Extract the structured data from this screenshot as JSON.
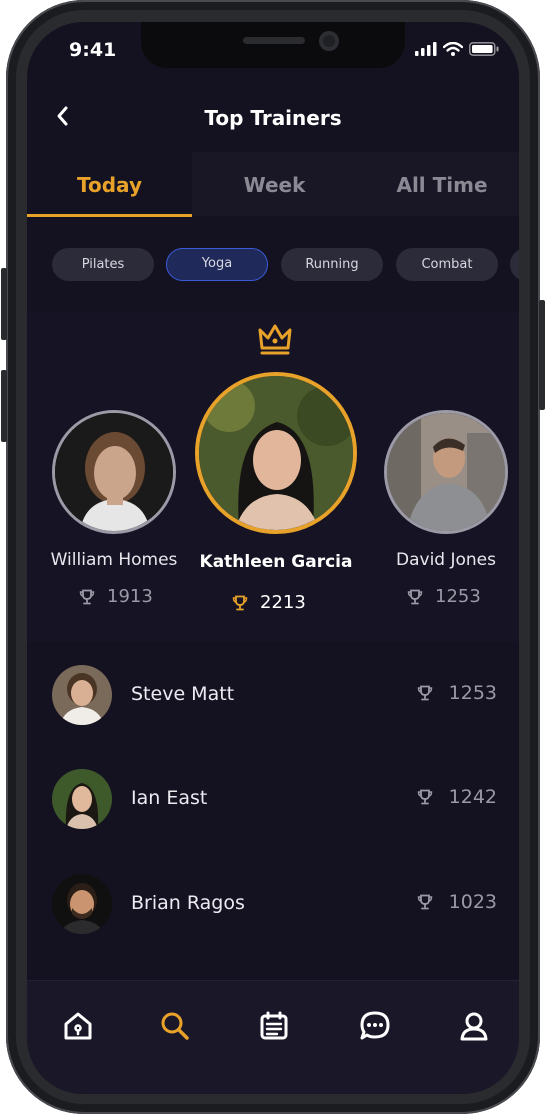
{
  "status": {
    "time": "9:41"
  },
  "header": {
    "title": "Top Trainers"
  },
  "tabs": [
    {
      "label": "Today",
      "active": true
    },
    {
      "label": "Week",
      "active": false
    },
    {
      "label": "All Time",
      "active": false
    }
  ],
  "categories": [
    {
      "label": "Pilates",
      "active": false
    },
    {
      "label": "Yoga",
      "active": true
    },
    {
      "label": "Running",
      "active": false
    },
    {
      "label": "Combat",
      "active": false
    }
  ],
  "podium": {
    "first": {
      "name": "Kathleen Garcia",
      "score": "2213",
      "icon": "crown-icon"
    },
    "second": {
      "name": "William Homes",
      "score": "1913"
    },
    "third": {
      "name": "David Jones",
      "score": "1253"
    }
  },
  "list": [
    {
      "name": "Steve Matt",
      "score": "1253"
    },
    {
      "name": "Ian East",
      "score": "1242"
    },
    {
      "name": "Brian Ragos",
      "score": "1023"
    }
  ],
  "nav": {
    "items": [
      "home-icon",
      "search-icon",
      "calendar-icon",
      "chat-icon",
      "profile-icon"
    ],
    "active": "search-icon"
  },
  "colors": {
    "accent": "#e8a22a",
    "background": "#141220",
    "chip_active_border": "#3b5bd8"
  }
}
